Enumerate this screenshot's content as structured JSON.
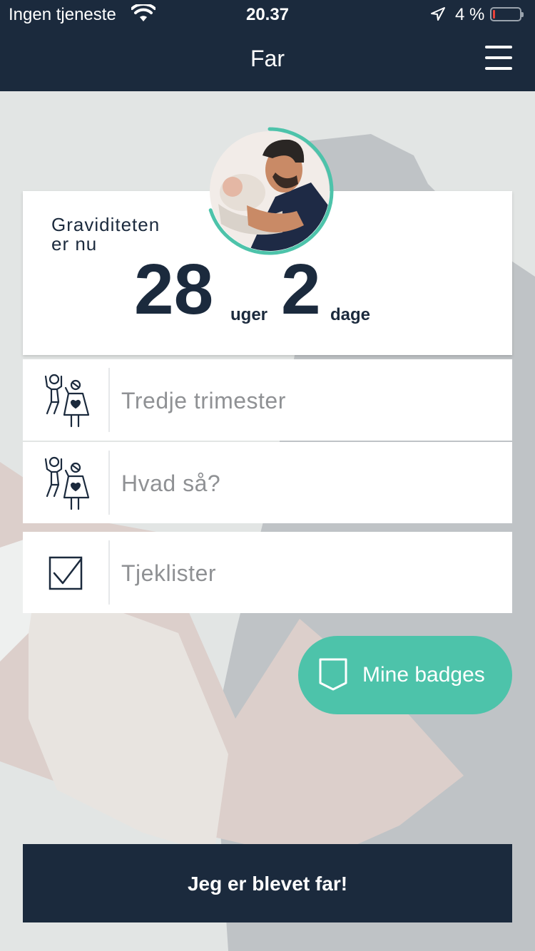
{
  "status_bar": {
    "carrier": "Ingen tjeneste",
    "time": "20.37",
    "battery": "4 %",
    "battery_level_fraction": 0.04
  },
  "header": {
    "title": "Far",
    "menu_icon": "hamburger-menu-icon"
  },
  "pregnancy": {
    "label_line1": "Graviditeten",
    "label_line2": "er nu",
    "weeks": "28",
    "weeks_unit": "uger",
    "days": "2",
    "days_unit": "dage",
    "progress_fraction": 0.7
  },
  "menu_items": [
    {
      "label": "Tredje trimester",
      "icon": "family-icon"
    },
    {
      "label": "Hvad så?",
      "icon": "family-icon"
    },
    {
      "label": "Tjeklister",
      "icon": "checkbox-icon"
    }
  ],
  "badges_button": {
    "label": "Mine badges",
    "icon": "shield-icon"
  },
  "cta_button": {
    "label": "Jeg er blevet far!"
  },
  "colors": {
    "navy": "#1b2a3d",
    "teal": "#4dc3aa",
    "background": "#e2e5e4",
    "gray_text": "#8f9194"
  }
}
